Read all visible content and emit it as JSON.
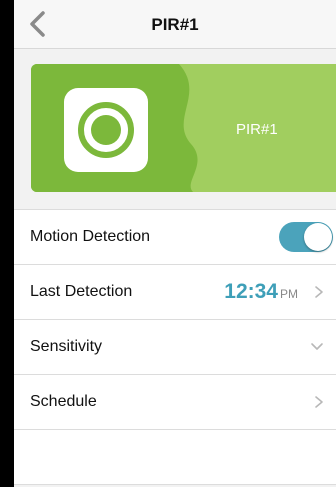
{
  "nav": {
    "title": "PIR#1",
    "back_icon": "chevron-left-icon"
  },
  "device_card": {
    "name": "PIR#1",
    "icon": "pir-sensor-icon",
    "colors": {
      "dark_green": "#7cb83b",
      "light_green": "#a1ce5f",
      "icon_ring": "#7cb83b"
    }
  },
  "settings": {
    "motion_detection": {
      "label": "Motion Detection",
      "enabled": true,
      "toggle_color": "#4ba3bb"
    },
    "last_detection": {
      "label": "Last Detection",
      "time": "12:34",
      "period": "PM",
      "time_color": "#3e9fb8"
    },
    "sensitivity": {
      "label": "Sensitivity",
      "icon": "chevron-down-icon"
    },
    "schedule": {
      "label": "Schedule",
      "icon": "chevron-right-icon"
    }
  }
}
